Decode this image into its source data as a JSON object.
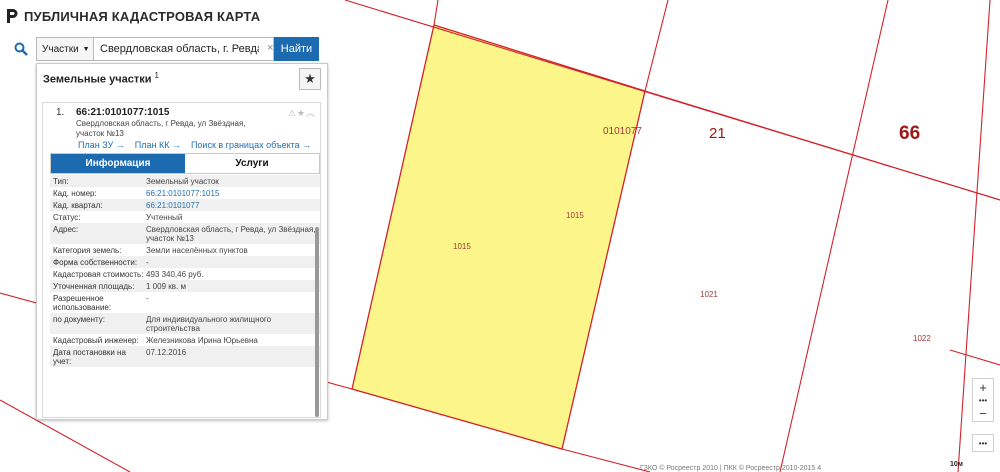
{
  "app": {
    "title": "ПУБЛИЧНАЯ КАДАСТРОВАЯ КАРТА"
  },
  "search": {
    "type_label": "Участки",
    "query": "Свердловская область, г. Ревда, ",
    "find_label": "Найти"
  },
  "panel": {
    "title": "Земельные участки",
    "count": "1",
    "item": {
      "number": "1.",
      "cad_number": "66:21:0101077:1015",
      "address_line1": "Свердловская область, г Ревда, ул Звёздная,",
      "address_line2": "участок №13",
      "links": [
        "План ЗУ →",
        "План КК →",
        "Поиск в границах объекта →"
      ]
    },
    "tabs": [
      "Информация",
      "Услуги"
    ],
    "properties": [
      {
        "key": "Тип:",
        "value": "Земельный участок"
      },
      {
        "key": "Кад. номер:",
        "value": "66:21:0101077:1015",
        "link": true
      },
      {
        "key": "Кад. квартал:",
        "value": "66:21:0101077",
        "link": true
      },
      {
        "key": "Статус:",
        "value": "Учтенный"
      },
      {
        "key": "Адрес:",
        "value": "Свердловская область, г Ревда, ул Звёздная, участок №13"
      },
      {
        "key": "Категория земель:",
        "value": "Земли населённых пунктов"
      },
      {
        "key": "Форма собственности:",
        "value": "-"
      },
      {
        "key": "Кадастровая стоимость:",
        "value": "493 340,46 руб."
      },
      {
        "key": "Уточненная площадь:",
        "value": "1 009 кв. м"
      },
      {
        "key": "Разрешенное использование:",
        "value": "-"
      },
      {
        "key": "по документу:",
        "value": "Для индивидуального жилищного строительства"
      },
      {
        "key": "Кадастровый инженер:",
        "value": "Железникова Ирина Юрьевна"
      },
      {
        "key": "Дата постановки на учет:",
        "value": "07.12.2016"
      },
      {
        "key": "",
        "value": ""
      }
    ]
  },
  "map": {
    "parcel_fill": "#fcf68a",
    "line_color": "#d2222a",
    "labels": {
      "parcel_a": "1015",
      "parcel_b": "1015",
      "quarter": "0101077",
      "district": "21",
      "region": "66",
      "parcel_c": "1021",
      "parcel_d": "1022"
    },
    "scale": "10м",
    "copyright": "ГЗКО © Росреестр 2010 | ПКК © Росреестр 2010-2015 4"
  },
  "zoom": {
    "in": "+",
    "out": "−"
  },
  "icons": {
    "logo": "rosreestr-logo-icon",
    "search": "search-icon",
    "star": "star-icon",
    "warning": "warning-icon",
    "chevron": "chevron-up-icon"
  }
}
